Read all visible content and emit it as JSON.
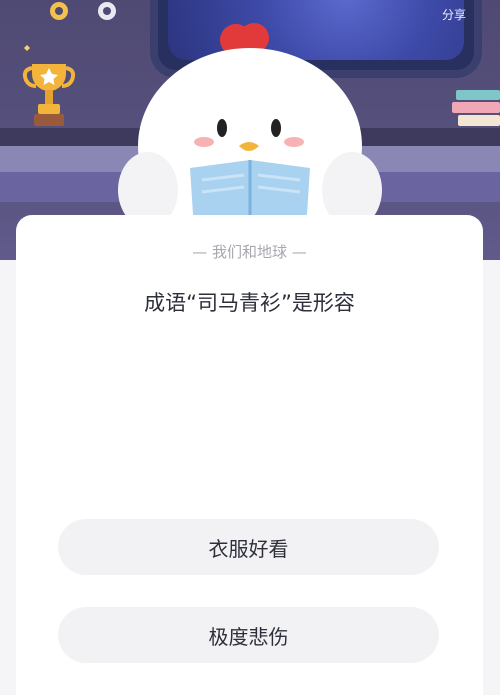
{
  "header": {
    "share_label": "分享"
  },
  "quiz": {
    "section_label": "— 我们和地球 —",
    "question": "成语“司马青衫”是形容",
    "options": [
      "衣服好看",
      "极度悲伤"
    ]
  },
  "icons": {
    "gears": "gear-icon",
    "trophy": "trophy-icon",
    "mascot": "chicken-mascot",
    "books": "book-stack"
  },
  "colors": {
    "scene_bg": "#57517e",
    "card_bg": "#ffffff",
    "option_bg": "#f2f2f5",
    "label_text": "#a7a7b0",
    "question_text": "#2d2f3a",
    "comb_red": "#e23a3a",
    "book_blue": "#a9d2f0"
  }
}
